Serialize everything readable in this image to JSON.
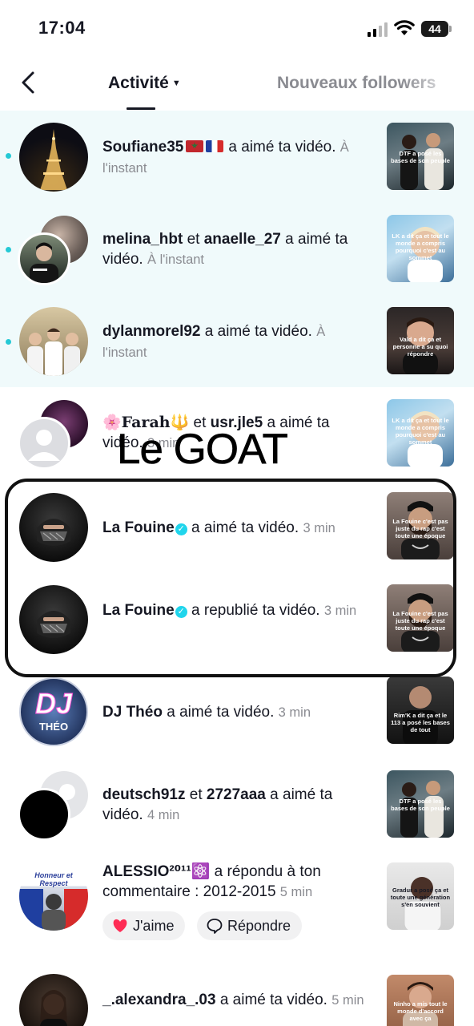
{
  "status_bar": {
    "time": "17:04",
    "battery": "44"
  },
  "nav": {
    "tabs": [
      {
        "label": "Activité",
        "active": true
      },
      {
        "label": "Nouveaux followers",
        "active": false
      }
    ]
  },
  "notifications": [
    {
      "user1": "Soufiane35",
      "user1_flags": [
        "morocco-flag",
        "france-flag"
      ],
      "action": "a aimé ta vidéo.",
      "time": "À l'instant",
      "unread": true,
      "thumb_caption": "DTF a posé les bases de son peuple"
    },
    {
      "user1": "melina_hbt",
      "conjunction": "et",
      "user2": "anaelle_27",
      "action": "a aimé ta vidéo.",
      "time": "À l'instant",
      "unread": true,
      "thumb_caption": "LK a dit ça et tout le monde a compris pourquoi c'est au sommet"
    },
    {
      "user1": "dylanmorel92",
      "action": "a aimé ta vidéo.",
      "time": "À l'instant",
      "unread": true,
      "thumb_caption": "Vald a dit ça et personne a su quoi répondre"
    },
    {
      "user1_prefix": "🌸",
      "user1": "Farah",
      "user1_suffix": "🔱",
      "conjunction": "et",
      "user2": "usr.jle5",
      "action": "a aimé ta vidéo.",
      "time": "3 min",
      "unread": false,
      "thumb_caption": "LK a dit ça et tout le monde a compris pourquoi c'est au sommet"
    },
    {
      "user1": "La Fouine",
      "verified": true,
      "action": "a aimé ta vidéo.",
      "time": "3 min",
      "unread": false,
      "thumb_caption": "La Fouine c'est pas juste du rap c'est toute une époque"
    },
    {
      "user1": "La Fouine",
      "verified": true,
      "action": "a republié ta vidéo.",
      "time": "3 min",
      "unread": false,
      "thumb_caption": "La Fouine c'est pas juste du rap c'est toute une époque"
    },
    {
      "user1": "DJ Théo",
      "action": "a aimé ta vidéo.",
      "time": "3 min",
      "unread": false,
      "avatar_text": [
        "DJ",
        "THÉO"
      ],
      "thumb_caption": "Rim'K a dit ça et le 113 a posé les bases de tout"
    },
    {
      "user1": "deutsch91z",
      "conjunction": "et",
      "user2": "2727aaa",
      "action": "a aimé ta vidéo.",
      "time": "4 min",
      "unread": false,
      "thumb_caption": "DTF a posé les bases de son peuple"
    },
    {
      "user1": "ALESSIO²⁰¹¹",
      "user1_suffix": "⚛️",
      "action": "a répondu à ton commentaire : 2012-2015",
      "time": "5 min",
      "unread": false,
      "avatar_text": [
        "Honneur et Respect"
      ],
      "like_label": "J'aime",
      "reply_label": "Répondre",
      "thumb_caption": "Gradur a posé ça et toute une génération s'en souvient"
    },
    {
      "user1": "_.alexandra_.03",
      "action": "a aimé ta vidéo.",
      "time": "5 min",
      "unread": false,
      "thumb_caption": "Ninho a mis tout le monde d'accord avec ça"
    }
  ],
  "overlay": {
    "caption": "Le GOAT"
  }
}
